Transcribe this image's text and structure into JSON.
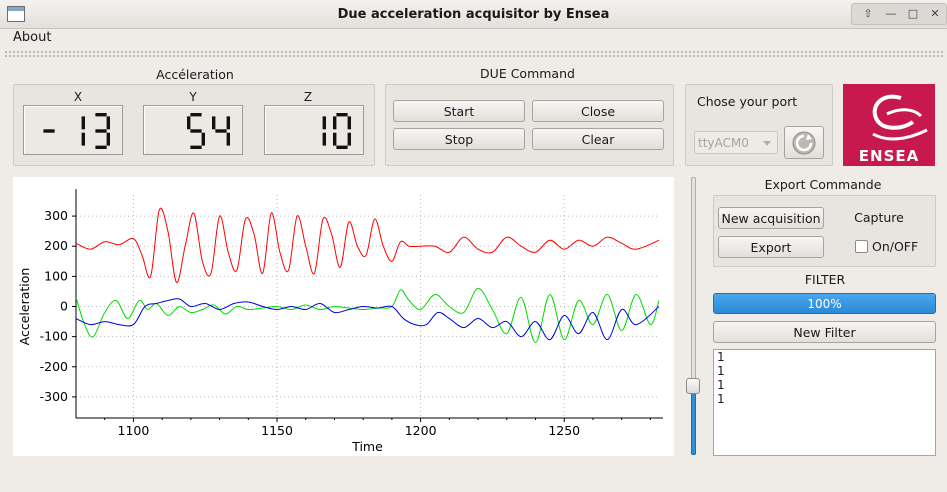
{
  "window": {
    "title": "Due acceleration acquisitor by Ensea"
  },
  "menu": {
    "about": "About"
  },
  "acceleration": {
    "title": "Accéleration",
    "x_label": "X",
    "y_label": "Y",
    "z_label": "Z",
    "x_value": "-13",
    "y_value": "54",
    "z_value": "10"
  },
  "due_command": {
    "title": "DUE Command",
    "start": "Start",
    "close": "Close",
    "stop": "Stop",
    "clear": "Clear"
  },
  "port": {
    "label": "Chose your port",
    "selected": "ttyACM0"
  },
  "logo": {
    "text": "ENSEA"
  },
  "export": {
    "title": "Export Commande",
    "new_acquisition": "New acquisition",
    "export": "Export",
    "capture_label": "Capture",
    "onoff_label": "On/OFF"
  },
  "filter": {
    "title": "FILTER",
    "progress_text": "100%",
    "progress": 1.0,
    "new_filter": "New Filter",
    "list": [
      "1",
      "1",
      "1",
      "1"
    ]
  },
  "slider": {
    "value": 0.25
  },
  "colors": {
    "x_series": "#ff0000",
    "y_series": "#00dd00",
    "z_series": "#0000dd",
    "accent": "#2a8ad6"
  },
  "chart_data": {
    "type": "line",
    "xlabel": "Time",
    "ylabel": "Acceleration",
    "xlim": [
      1080,
      1283
    ],
    "ylim": [
      -370,
      370
    ],
    "xticks": [
      1100,
      1150,
      1200,
      1250
    ],
    "yticks": [
      300,
      200,
      100,
      0,
      -100,
      -200,
      -300
    ],
    "grid": true,
    "series": [
      {
        "color": "#ff0000",
        "x": [
          1080,
          1085,
          1090,
          1095,
          1100,
          1103,
          1106,
          1109,
          1112,
          1115,
          1118,
          1121,
          1124,
          1127,
          1130,
          1133,
          1136,
          1139,
          1142,
          1145,
          1148,
          1151,
          1154,
          1157,
          1160,
          1163,
          1166,
          1169,
          1172,
          1175,
          1178,
          1181,
          1184,
          1187,
          1190,
          1193,
          1196,
          1200,
          1205,
          1210,
          1215,
          1220,
          1225,
          1230,
          1235,
          1240,
          1245,
          1250,
          1255,
          1260,
          1265,
          1270,
          1275,
          1283
        ],
        "y": [
          210,
          190,
          215,
          205,
          225,
          170,
          100,
          320,
          250,
          80,
          200,
          310,
          150,
          110,
          300,
          180,
          120,
          290,
          240,
          110,
          310,
          180,
          120,
          300,
          200,
          110,
          290,
          240,
          130,
          280,
          200,
          170,
          290,
          200,
          150,
          215,
          200,
          200,
          200,
          180,
          230,
          190,
          180,
          230,
          200,
          180,
          220,
          190,
          220,
          200,
          230,
          210,
          190,
          220
        ]
      },
      {
        "color": "#00dd00",
        "x": [
          1080,
          1083,
          1086,
          1090,
          1094,
          1098,
          1102,
          1105,
          1108,
          1112,
          1116,
          1120,
          1124,
          1128,
          1132,
          1136,
          1140,
          1145,
          1150,
          1155,
          1160,
          1165,
          1170,
          1175,
          1180,
          1185,
          1190,
          1193,
          1196,
          1200,
          1205,
          1210,
          1215,
          1220,
          1225,
          1230,
          1235,
          1240,
          1245,
          1250,
          1255,
          1260,
          1265,
          1270,
          1275,
          1280,
          1283
        ],
        "y": [
          30,
          -60,
          -100,
          -20,
          20,
          -40,
          20,
          -10,
          10,
          -30,
          0,
          -20,
          -10,
          5,
          -25,
          0,
          -10,
          -5,
          0,
          -10,
          5,
          -10,
          0,
          -5,
          -10,
          -5,
          0,
          55,
          20,
          -10,
          40,
          0,
          -20,
          60,
          -10,
          -90,
          30,
          -120,
          40,
          -110,
          20,
          -60,
          40,
          -80,
          40,
          -60,
          20
        ]
      },
      {
        "color": "#0000dd",
        "x": [
          1080,
          1085,
          1090,
          1095,
          1100,
          1104,
          1108,
          1112,
          1116,
          1120,
          1125,
          1130,
          1135,
          1140,
          1145,
          1150,
          1155,
          1160,
          1165,
          1170,
          1175,
          1180,
          1185,
          1190,
          1194,
          1198,
          1202,
          1206,
          1210,
          1215,
          1220,
          1225,
          1230,
          1235,
          1240,
          1245,
          1250,
          1255,
          1260,
          1265,
          1270,
          1275,
          1283
        ],
        "y": [
          -40,
          -60,
          -50,
          -60,
          -60,
          0,
          10,
          20,
          25,
          0,
          10,
          -10,
          10,
          15,
          0,
          -10,
          0,
          -10,
          10,
          -20,
          -10,
          0,
          -5,
          0,
          -40,
          -60,
          -60,
          -20,
          -40,
          -70,
          -40,
          -70,
          -50,
          -100,
          -50,
          -110,
          -30,
          -90,
          -20,
          -110,
          -10,
          -60,
          0
        ]
      }
    ]
  }
}
